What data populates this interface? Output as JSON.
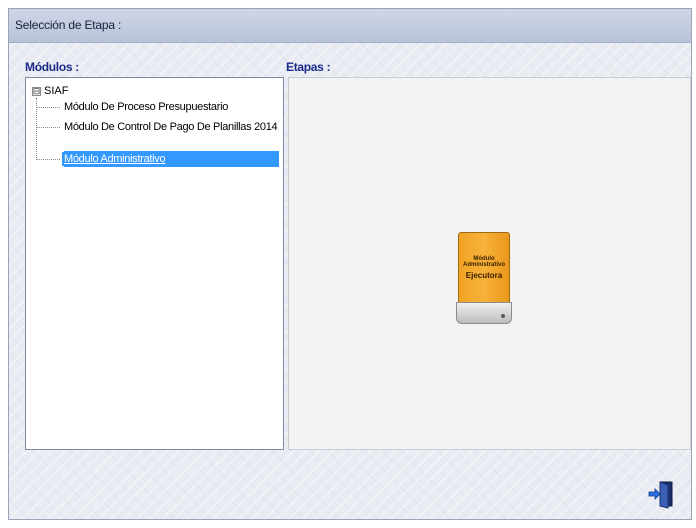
{
  "window": {
    "title": "Selección de Etapa :"
  },
  "modules_panel": {
    "label": "Módulos :",
    "tree": {
      "root": {
        "expander": "⊟",
        "label": "SIAF"
      },
      "items": [
        {
          "label": "Módulo De Proceso Presupuestario",
          "selected": false
        },
        {
          "label": "Módulo De Control De Pago De Planillas 2014",
          "selected": false
        },
        {
          "label": "Módulo Administrativo",
          "selected": true
        }
      ]
    }
  },
  "stages_panel": {
    "label": "Etapas :",
    "stage": {
      "line1": "Módulo",
      "line2": "Administrativo",
      "line3": "Ejecutora",
      "color": "#f7b23a"
    }
  },
  "footer": {
    "exit_icon": "exit-door-icon"
  },
  "colors": {
    "selection": "#3399ff",
    "section_label": "#1a2a8a"
  }
}
